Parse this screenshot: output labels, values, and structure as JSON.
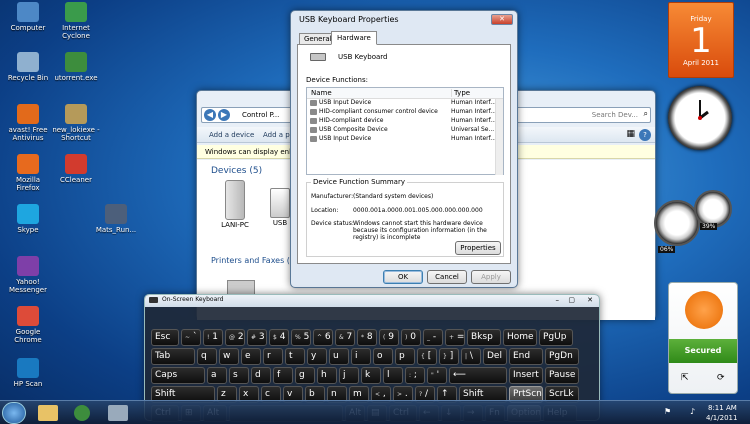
{
  "desktop": {
    "icons": [
      {
        "label": "Computer",
        "color": "#4d88c6"
      },
      {
        "label": "Internet Cyclone",
        "color": "#3a9b4b"
      },
      {
        "label": "Recycle Bin",
        "color": "#8fb0cf"
      },
      {
        "label": "utorrent.exe",
        "color": "#3d8d3d"
      },
      {
        "label": "avast! Free Antivirus",
        "color": "#e26a1b"
      },
      {
        "label": "new_lokiexe - Shortcut",
        "color": "#b59a5a"
      },
      {
        "label": "Mozilla Firefox",
        "color": "#e76a1e"
      },
      {
        "label": "CCleaner",
        "color": "#d23b2e"
      },
      {
        "label": "Skype",
        "color": "#1ea6e0"
      },
      {
        "label": "Mats_Run...",
        "color": "#4c5f7b"
      },
      {
        "label": "Yahoo! Messenger",
        "color": "#7e3fa8"
      },
      {
        "label": "Google Chrome",
        "color": "#dd4b39"
      },
      {
        "label": "HP Scan",
        "color": "#1979c0"
      }
    ]
  },
  "calendar": {
    "day": "Friday",
    "date": "1",
    "month": "April 2011"
  },
  "meter": {
    "cpu": "06%",
    "mem": "39%"
  },
  "explorer": {
    "address": "Control P...",
    "toolbar": [
      "Add a device",
      "Add a p..."
    ],
    "search_placeholder": "Search Dev...",
    "infobar": "Windows can display enhanc...",
    "devices_header": "Devices (5)",
    "devices": [
      {
        "label": "LANI-PC"
      },
      {
        "label": "USB"
      }
    ],
    "printers_header": "Printers and Faxes (4)"
  },
  "dialog": {
    "title": "USB Keyboard Properties",
    "tabs": [
      "General",
      "Hardware"
    ],
    "active_tab": "Hardware",
    "device_name": "USB Keyboard",
    "functions_label": "Device Functions:",
    "col_name": "Name",
    "col_type": "Type",
    "rows": [
      {
        "name": "USB Input Device",
        "type": "Human Interf..."
      },
      {
        "name": "HID-compliant consumer control device",
        "type": "Human Interf..."
      },
      {
        "name": "HID-compliant device",
        "type": "Human Interf..."
      },
      {
        "name": "USB Composite Device",
        "type": "Universal Se..."
      },
      {
        "name": "USB Input Device",
        "type": "Human Interf..."
      }
    ],
    "summary_title": "Device Function Summary",
    "manufacturer_label": "Manufacturer:",
    "manufacturer": "(Standard system devices)",
    "location_label": "Location:",
    "location": "0000.001a.0000.001.005.000.000.000.000",
    "status_label": "Device status:",
    "status": "Windows cannot start this hardware device because its configuration information (in the registry) is incomplete",
    "properties_btn": "Properties",
    "ok": "OK",
    "cancel": "Cancel",
    "apply": "Apply"
  },
  "osk": {
    "title": "On-Screen Keyboard"
  },
  "avast": {
    "status": "Secured"
  },
  "taskbar": {
    "time": "8:11 AM",
    "date": "4/1/2011"
  }
}
